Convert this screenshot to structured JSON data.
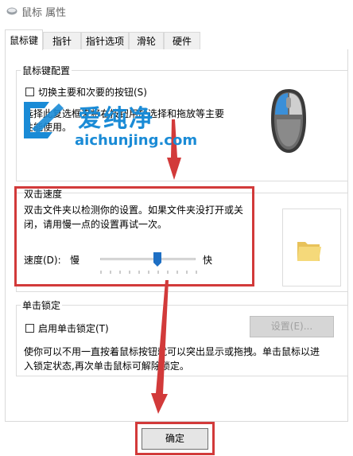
{
  "window": {
    "title": "鼠标 属性"
  },
  "tabs": [
    {
      "label": "鼠标键"
    },
    {
      "label": "指针"
    },
    {
      "label": "指针选项"
    },
    {
      "label": "滑轮"
    },
    {
      "label": "硬件"
    }
  ],
  "button_config": {
    "group_label": "鼠标键配置",
    "switch_label": "切换主要和次要的按钮(S)",
    "desc_line1": "选择此复选框来将右按钮用於选择和拖放等主要",
    "desc_line2": "性能使用。"
  },
  "double_click": {
    "group_label": "双击速度",
    "desc_line1": "双击文件夹以检测你的设置。如果文件夹没打开或关",
    "desc_line2": "闭，请用慢一点的设置再试一次。",
    "speed_label": "速度(D):",
    "slow": "慢",
    "fast": "快",
    "slider_level": 0.6
  },
  "click_lock": {
    "group_label": "单击锁定",
    "enable_label": "启用单击锁定(T)",
    "settings_button": "设置(E)...",
    "desc_line1": "使你可以不用一直按着鼠标按钮就可以突出显示或拖拽。单击鼠标以进",
    "desc_line2": "入锁定状态,再次单击鼠标可解除锁定。"
  },
  "footer": {
    "ok_button": "确定"
  },
  "watermark": {
    "brand": "爱纯净",
    "url": "aichunjing.com"
  },
  "colors": {
    "highlight_red": "#d23a3a",
    "mouse_blue": "#3a8fd8",
    "watermark_blue": "#1a8bd6"
  }
}
